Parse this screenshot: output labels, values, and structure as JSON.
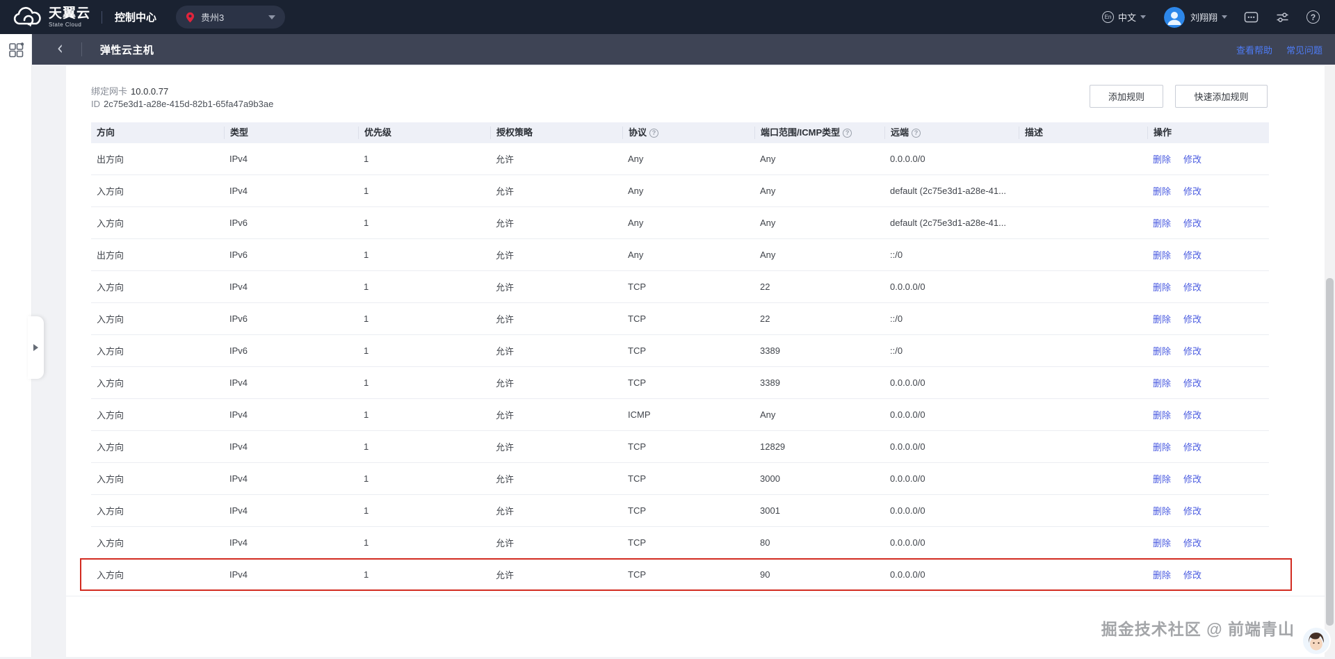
{
  "topbar": {
    "logo_title": "天翼云",
    "logo_subtitle": "State Cloud",
    "console_label": "控制中心",
    "region": "贵州3",
    "lang_badge": "En",
    "lang_label": "中文",
    "username": "刘翔翔"
  },
  "subheader": {
    "title": "弹性云主机",
    "help_link": "查看帮助",
    "faq_link": "常见问题"
  },
  "panel": {
    "nic_label": "绑定网卡",
    "nic_value": "10.0.0.77",
    "id_label": "ID",
    "id_value": "2c75e3d1-a28e-415d-82b1-65fa47a9b3ae",
    "add_rule_button": "添加规则",
    "quick_add_rule_button": "快速添加规则"
  },
  "table": {
    "columns": [
      {
        "key": "direction",
        "label": "方向",
        "help": false
      },
      {
        "key": "type",
        "label": "类型",
        "help": false
      },
      {
        "key": "priority",
        "label": "优先级",
        "help": false
      },
      {
        "key": "policy",
        "label": "授权策略",
        "help": false
      },
      {
        "key": "protocol",
        "label": "协议",
        "help": true
      },
      {
        "key": "port_range",
        "label": "端口范围/ICMP类型",
        "help": true
      },
      {
        "key": "remote",
        "label": "远端",
        "help": true
      },
      {
        "key": "description",
        "label": "描述",
        "help": false
      },
      {
        "key": "actions",
        "label": "操作",
        "help": false
      }
    ],
    "actions": {
      "delete": "删除",
      "modify": "修改"
    },
    "highlighted_row_index": 13,
    "rows": [
      {
        "direction": "出方向",
        "type": "IPv4",
        "priority": "1",
        "policy": "允许",
        "protocol": "Any",
        "port_range": "Any",
        "remote": "0.0.0.0/0",
        "description": ""
      },
      {
        "direction": "入方向",
        "type": "IPv4",
        "priority": "1",
        "policy": "允许",
        "protocol": "Any",
        "port_range": "Any",
        "remote": "default (2c75e3d1-a28e-41...",
        "description": ""
      },
      {
        "direction": "入方向",
        "type": "IPv6",
        "priority": "1",
        "policy": "允许",
        "protocol": "Any",
        "port_range": "Any",
        "remote": "default (2c75e3d1-a28e-41...",
        "description": ""
      },
      {
        "direction": "出方向",
        "type": "IPv6",
        "priority": "1",
        "policy": "允许",
        "protocol": "Any",
        "port_range": "Any",
        "remote": "::/0",
        "description": ""
      },
      {
        "direction": "入方向",
        "type": "IPv4",
        "priority": "1",
        "policy": "允许",
        "protocol": "TCP",
        "port_range": "22",
        "remote": "0.0.0.0/0",
        "description": ""
      },
      {
        "direction": "入方向",
        "type": "IPv6",
        "priority": "1",
        "policy": "允许",
        "protocol": "TCP",
        "port_range": "22",
        "remote": "::/0",
        "description": ""
      },
      {
        "direction": "入方向",
        "type": "IPv6",
        "priority": "1",
        "policy": "允许",
        "protocol": "TCP",
        "port_range": "3389",
        "remote": "::/0",
        "description": ""
      },
      {
        "direction": "入方向",
        "type": "IPv4",
        "priority": "1",
        "policy": "允许",
        "protocol": "TCP",
        "port_range": "3389",
        "remote": "0.0.0.0/0",
        "description": ""
      },
      {
        "direction": "入方向",
        "type": "IPv4",
        "priority": "1",
        "policy": "允许",
        "protocol": "ICMP",
        "port_range": "Any",
        "remote": "0.0.0.0/0",
        "description": ""
      },
      {
        "direction": "入方向",
        "type": "IPv4",
        "priority": "1",
        "policy": "允许",
        "protocol": "TCP",
        "port_range": "12829",
        "remote": "0.0.0.0/0",
        "description": ""
      },
      {
        "direction": "入方向",
        "type": "IPv4",
        "priority": "1",
        "policy": "允许",
        "protocol": "TCP",
        "port_range": "3000",
        "remote": "0.0.0.0/0",
        "description": ""
      },
      {
        "direction": "入方向",
        "type": "IPv4",
        "priority": "1",
        "policy": "允许",
        "protocol": "TCP",
        "port_range": "3001",
        "remote": "0.0.0.0/0",
        "description": ""
      },
      {
        "direction": "入方向",
        "type": "IPv4",
        "priority": "1",
        "policy": "允许",
        "protocol": "TCP",
        "port_range": "80",
        "remote": "0.0.0.0/0",
        "description": ""
      },
      {
        "direction": "入方向",
        "type": "IPv4",
        "priority": "1",
        "policy": "允许",
        "protocol": "TCP",
        "port_range": "90",
        "remote": "0.0.0.0/0",
        "description": ""
      }
    ]
  },
  "watermark": {
    "text": "掘金技术社区 @ 前端青山"
  },
  "colors": {
    "navbar_bg": "#1a2231",
    "subheader_bg": "#3e4455",
    "pin_red": "#e0243c",
    "header_link_blue": "#4e7cf6",
    "action_link_blue": "#4a5be0",
    "table_header_bg": "#eef0f7",
    "highlight_red": "#d22b20"
  }
}
